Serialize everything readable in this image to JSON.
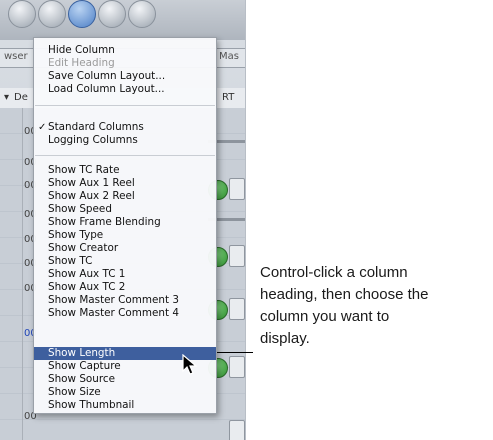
{
  "window": {
    "tabs": [
      "wser",
      "Mas"
    ],
    "headers": [
      "De",
      "RT"
    ],
    "row_numbers": [
      "00",
      "00",
      "00",
      "00",
      "00",
      "00",
      "00",
      "00",
      "00",
      "00"
    ]
  },
  "menu": {
    "items": [
      {
        "label": "Hide Column"
      },
      {
        "label": "Edit Heading",
        "disabled": true
      },
      {
        "label": "Save Column Layout..."
      },
      {
        "label": "Load Column Layout..."
      },
      {
        "label": "Standard Columns",
        "checked": true
      },
      {
        "label": "Logging Columns"
      },
      {
        "label": "Show TC Rate"
      },
      {
        "label": "Show Aux 1 Reel"
      },
      {
        "label": "Show Aux 2 Reel"
      },
      {
        "label": "Show Speed"
      },
      {
        "label": "Show Frame Blending"
      },
      {
        "label": "Show Type"
      },
      {
        "label": "Show Creator"
      },
      {
        "label": "Show TC"
      },
      {
        "label": "Show Aux TC 1"
      },
      {
        "label": "Show Aux TC 2"
      },
      {
        "label": "Show Master Comment 3"
      },
      {
        "label": "Show Master Comment 4"
      },
      {
        "label": "Show Length",
        "highlighted": true
      },
      {
        "label": "Show Capture"
      },
      {
        "label": "Show Source"
      },
      {
        "label": "Show Size"
      },
      {
        "label": "Show Thumbnail"
      }
    ],
    "check_glyph": "✓",
    "highlight_color": "#3e5f9e"
  },
  "callout": {
    "lines": [
      "Control-click a column",
      "heading, then choose the",
      "column you want to",
      "display."
    ]
  },
  "icons": {
    "cursor": "arrow-cursor-icon",
    "column_menu": "column-menu-icon"
  }
}
